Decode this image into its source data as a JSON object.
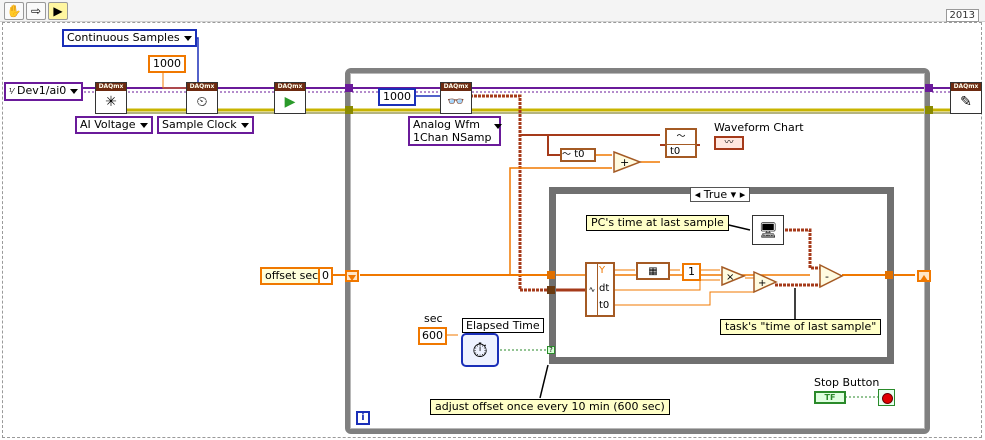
{
  "toolbar": {
    "hand_icon": "hand-icon",
    "arrow_icon": "arrow-icon",
    "run_icon": "highlight-icon",
    "year": "2013"
  },
  "constants": {
    "sample_mode": "Continuous Samples",
    "samples_per_chan": "1000",
    "channel": "Dev1/ai0",
    "read_samples": "1000",
    "offset_sec": "0",
    "elapsed_sec": "600"
  },
  "rings": {
    "measurement": "AI Voltage",
    "timing": "Sample Clock",
    "read_type_line1": "Analog Wfm",
    "read_type_line2": "1Chan NSamp"
  },
  "labels": {
    "offset": "offset sec",
    "sec": "sec",
    "elapsed_time": "Elapsed Time",
    "waveform_chart": "Waveform Chart",
    "stop_button": "Stop Button",
    "case_selector": "True",
    "t0_a": "t0",
    "t0_b": "t0",
    "unbundle_y": "Y",
    "unbundle_dt": "dt",
    "unbundle_t0": "t0",
    "const_one": "1",
    "iter": "i",
    "bool_tf": "TF",
    "daqmx": "DAQmx"
  },
  "notes": {
    "pc_time": "PC's time at last sample",
    "task_time": "task's \"time of last sample\"",
    "adjust_offset": "adjust offset once every 10 min (600 sec)"
  },
  "colors": {
    "waveform_wire": "#a53a1a",
    "timestamp_wire": "#f07800",
    "task_wire": "#6a1a9a",
    "error_wire": "#c8b400",
    "numeric_blue": "#1a2fb8",
    "loop_border": "#808080"
  }
}
